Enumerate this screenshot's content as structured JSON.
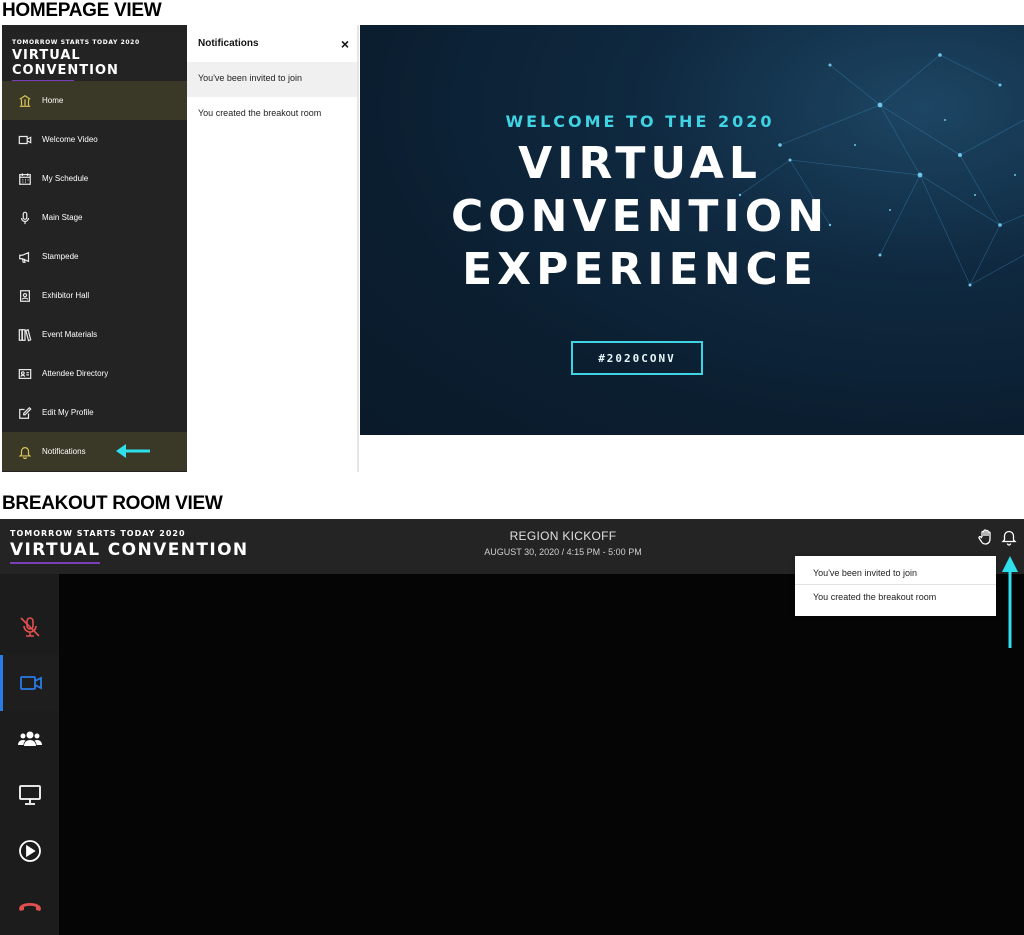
{
  "sections": {
    "homepage_title": "HOMEPAGE VIEW",
    "breakout_title": "BREAKOUT ROOM VIEW"
  },
  "brand": {
    "tagline": "TOMORROW STARTS TODAY 2020",
    "name": "VIRTUAL CONVENTION",
    "underline_color": "#7b3fb8"
  },
  "homepage": {
    "sidebar": {
      "items": [
        {
          "label": "Home",
          "icon": "home-icon",
          "active": true
        },
        {
          "label": "Welcome Video",
          "icon": "video-icon"
        },
        {
          "label": "My Schedule",
          "icon": "calendar-icon"
        },
        {
          "label": "Main Stage",
          "icon": "microphone-icon"
        },
        {
          "label": "Stampede",
          "icon": "megaphone-icon"
        },
        {
          "label": "Exhibitor Hall",
          "icon": "badge-icon"
        },
        {
          "label": "Event Materials",
          "icon": "books-icon"
        },
        {
          "label": "Attendee Directory",
          "icon": "contact-card-icon"
        },
        {
          "label": "Edit My Profile",
          "icon": "edit-icon"
        },
        {
          "label": "Notifications",
          "icon": "bell-icon",
          "active": true
        }
      ]
    },
    "notifications": {
      "title": "Notifications",
      "close": "×",
      "items": [
        "You've been invited to join",
        "You created the breakout room"
      ]
    },
    "hero": {
      "subtitle": "WELCOME TO THE 2020",
      "line1": "VIRTUAL",
      "line2": "CONVENTION",
      "line3": "EXPERIENCE",
      "hashtag": "#2020CONV",
      "accent_color": "#3fd3e3"
    }
  },
  "breakout": {
    "room_title": "REGION KICKOFF",
    "room_date": "AUGUST 30, 2020 / 4:15 PM - 5:00 PM",
    "top_icons": [
      "raise-hand-icon",
      "bell-icon"
    ],
    "dropdown": [
      "You've been invited to join",
      "You created the breakout room"
    ],
    "side_buttons": [
      {
        "icon": "muted-microphone-icon",
        "color": "#e05050"
      },
      {
        "icon": "video-camera-icon",
        "color": "#2a7be4",
        "active": true
      },
      {
        "icon": "participants-icon",
        "color": "#ffffff"
      },
      {
        "icon": "screen-share-icon",
        "color": "#ffffff"
      },
      {
        "icon": "play-icon",
        "color": "#ffffff"
      },
      {
        "icon": "hang-up-icon",
        "color": "#e05050"
      }
    ]
  },
  "annotation_arrow_color": "#2fe0ec"
}
